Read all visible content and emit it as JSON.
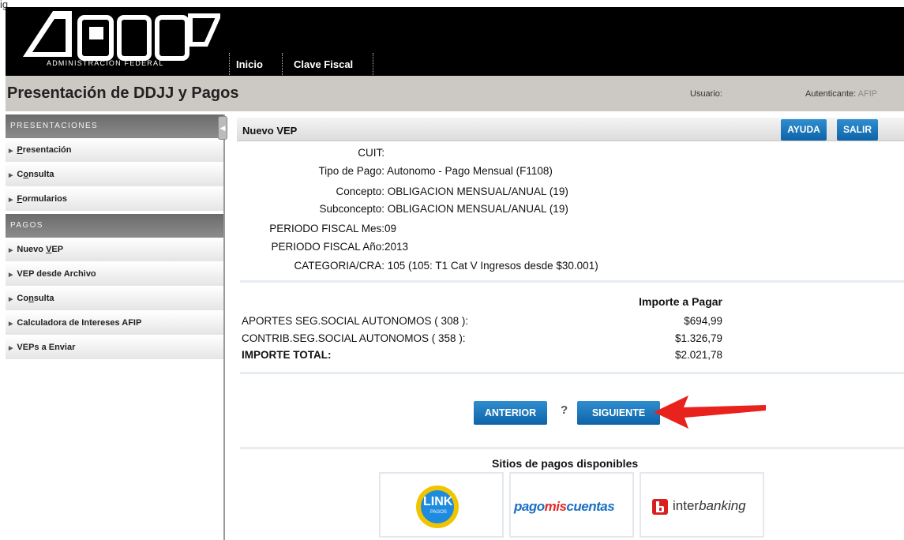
{
  "corner_text": "ig",
  "header": {
    "logo_caption": "ADMINISTRACION FEDERAL",
    "nav": [
      "Inicio",
      "Clave Fiscal"
    ]
  },
  "titlebar": {
    "title": "Presentación de DDJJ y Pagos",
    "user_label": "Usuario:",
    "auth_label": "Autenticante:",
    "auth_value": "AFIP"
  },
  "sidebar": {
    "presentaciones_header": "PRESENTACIONES",
    "presentaciones_items": [
      {
        "pre": "",
        "ul": "P",
        "post": "resentación"
      },
      {
        "pre": "C",
        "ul": "o",
        "post": "nsulta"
      },
      {
        "pre": "",
        "ul": "F",
        "post": "ormularios"
      }
    ],
    "pagos_header": "PAGOS",
    "pagos_items": [
      {
        "pre": "Nuevo ",
        "ul": "V",
        "post": "EP"
      },
      {
        "pre": "VEP desde Archivo",
        "ul": "",
        "post": ""
      },
      {
        "pre": "Co",
        "ul": "n",
        "post": "sulta"
      },
      {
        "pre": "Calculadora de Intereses AFIP",
        "ul": "",
        "post": ""
      },
      {
        "pre": "VEPs a Enviar",
        "ul": "",
        "post": ""
      }
    ]
  },
  "main": {
    "title": "Nuevo VEP",
    "ayuda": "AYUDA",
    "salir": "SALIR",
    "fields": [
      {
        "label": "CUIT:",
        "value": ""
      },
      {
        "label": "Tipo de Pago:",
        "value": "Autonomo - Pago Mensual (F1108)"
      },
      {
        "label": "Concepto:",
        "value": "OBLIGACION MENSUAL/ANUAL (19)"
      },
      {
        "label": "Subconcepto:",
        "value": "OBLIGACION MENSUAL/ANUAL (19)"
      },
      {
        "label": "PERIODO FISCAL Mes:",
        "value": "09"
      },
      {
        "label": "PERIODO FISCAL Año:",
        "value": "2013"
      },
      {
        "label": "CATEGORIA/CRA:",
        "value": "105 (105: T1 Cat V Ingresos desde $30.001)"
      }
    ],
    "importe_header": "Importe a Pagar",
    "amounts": [
      {
        "label": "APORTES SEG.SOCIAL AUTONOMOS ( 308 ):",
        "value": "$694,99"
      },
      {
        "label": "CONTRIB.SEG.SOCIAL AUTONOMOS ( 358 ):",
        "value": "$1.326,79"
      }
    ],
    "total_label": "IMPORTE TOTAL:",
    "total_value": "$2.021,78",
    "btn_anterior": "ANTERIOR",
    "help_mark": "?",
    "btn_siguiente": "SIGUIENTE",
    "sitios_title": "Sitios de pagos disponibles",
    "link_logo_text": "LINK",
    "link_logo_sub": "PAGOS",
    "pagomiscuentas": {
      "part1": "pago",
      "part2": "mis",
      "part3": "cuentas"
    },
    "interbanking": {
      "part1": "inter",
      "part2": "banking"
    }
  }
}
